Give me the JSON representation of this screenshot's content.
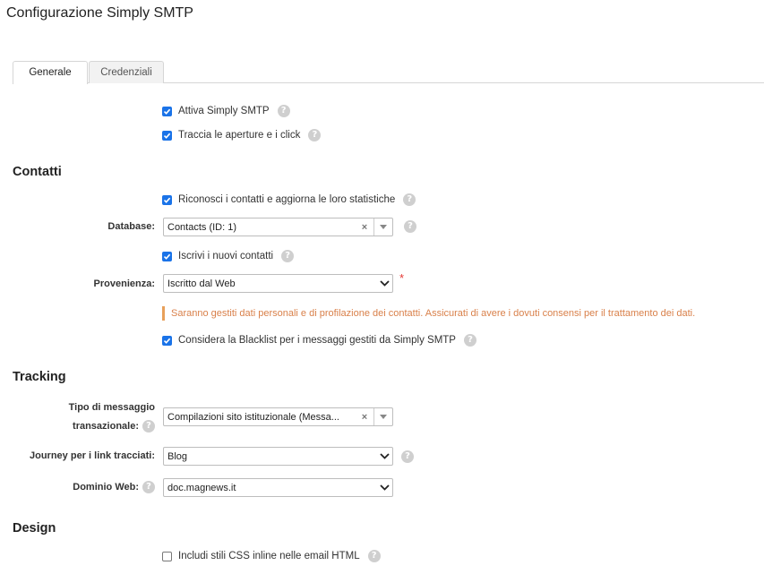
{
  "page": {
    "title": "Configurazione Simply SMTP"
  },
  "tabs": [
    {
      "label": "Generale",
      "active": true
    },
    {
      "label": "Credenziali",
      "active": false
    }
  ],
  "general": {
    "enable": {
      "label": "Attiva Simply SMTP",
      "checked": true
    },
    "track_opens": {
      "label": "Traccia le aperture e i click",
      "checked": true
    }
  },
  "contacts": {
    "heading": "Contatti",
    "recognize": {
      "label": "Riconosci i contatti e aggiorna le loro statistiche",
      "checked": true
    },
    "database": {
      "label": "Database:",
      "value": "Contacts (ID: 1)"
    },
    "subscribe": {
      "label": "Iscrivi i nuovi contatti",
      "checked": true
    },
    "origin": {
      "label": "Provenienza:",
      "value": "Iscritto dal Web",
      "required_mark": "*"
    },
    "warning": "Saranno gestiti dati personali e di profilazione dei contatti. Assicurati di avere i dovuti consensi per il trattamento dei dati.",
    "blacklist": {
      "label": "Considera la Blacklist per i messaggi gestiti da Simply SMTP",
      "checked": true
    }
  },
  "tracking": {
    "heading": "Tracking",
    "message_type": {
      "label_line1": "Tipo di messaggio",
      "label_line2": "transazionale:",
      "value": "Compilazioni sito istituzionale (Messa..."
    },
    "journey": {
      "label": "Journey per i link tracciati:",
      "value": "Blog"
    },
    "domain": {
      "label": "Dominio Web:",
      "value": "doc.magnews.it"
    }
  },
  "design": {
    "heading": "Design",
    "inline_css": {
      "label": "Includi stili CSS inline nelle email HTML",
      "checked": false
    }
  },
  "icons": {
    "help": "?",
    "clear": "×"
  },
  "colors": {
    "checkbox": "#1a73e8",
    "help": "#cfcfcf",
    "warning_text": "#d9804a",
    "warning_bar": "#e8a05a",
    "required": "#e53935"
  }
}
